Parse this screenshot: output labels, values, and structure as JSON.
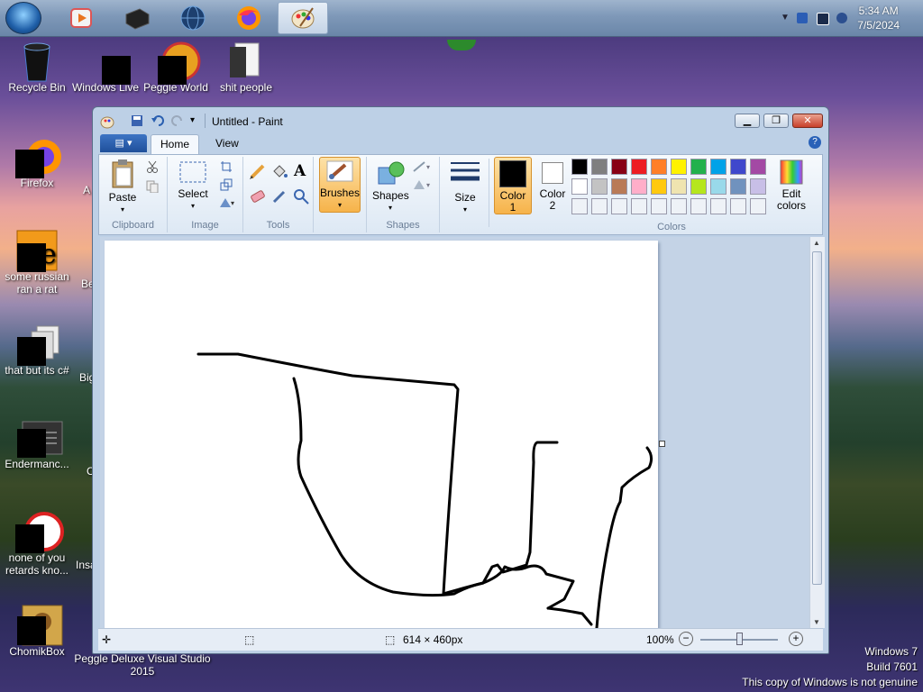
{
  "taskbar": {
    "clock_time": "5:34 AM",
    "clock_date": "7/5/2024",
    "pinned": [
      "media-player-icon",
      "black-app-icon",
      "globe-icon",
      "firefox-icon",
      "paint-icon"
    ]
  },
  "desktop": {
    "icons": [
      {
        "label": "Recycle Bin"
      },
      {
        "label": "Windows Live"
      },
      {
        "label": "Peggle World"
      },
      {
        "label": "shit people"
      },
      {
        "label": "Firefox"
      },
      {
        "label": "some russian ran a rat"
      },
      {
        "label": "that but its c#"
      },
      {
        "label": "Endermanc..."
      },
      {
        "label": "none of you retards kno..."
      },
      {
        "label": "ChomikBox"
      }
    ],
    "partial_labels": {
      "col2_a": "A",
      "col2_b": "Be",
      "col2_c": "Big",
      "col2_d": "C",
      "col2_e": "Insa",
      "bottom": "Peggle Deluxe Visual Studio 2015"
    }
  },
  "watermark": {
    "line1": "Windows 7",
    "line2": "Build 7601",
    "line3": "This copy of Windows is not genuine"
  },
  "paint": {
    "title": "Untitled - Paint",
    "tabs": {
      "home": "Home",
      "view": "View"
    },
    "groups": {
      "clipboard": "Clipboard",
      "image": "Image",
      "tools": "Tools",
      "shapes": "Shapes",
      "colors": "Colors"
    },
    "buttons": {
      "paste": "Paste",
      "select": "Select",
      "brushes": "Brushes",
      "shapes": "Shapes",
      "size": "Size",
      "color1_a": "Color",
      "color1_b": "1",
      "color2_a": "Color",
      "color2_b": "2",
      "edit_a": "Edit",
      "edit_b": "colors"
    },
    "palette_row1": [
      "#000000",
      "#7f7f7f",
      "#880015",
      "#ed1c24",
      "#ff7f27",
      "#fff200",
      "#22b14c",
      "#00a2e8",
      "#3f48cc",
      "#a349a4"
    ],
    "palette_row2": [
      "#ffffff",
      "#c3c3c3",
      "#b97a57",
      "#ffaec9",
      "#ffc90e",
      "#efe4b0",
      "#b5e61d",
      "#99d9ea",
      "#7092be",
      "#c8bfe7"
    ],
    "color1": "#000000",
    "color2": "#ffffff",
    "status": {
      "canvas_size": "614 × 460px",
      "zoom": "100%"
    }
  }
}
